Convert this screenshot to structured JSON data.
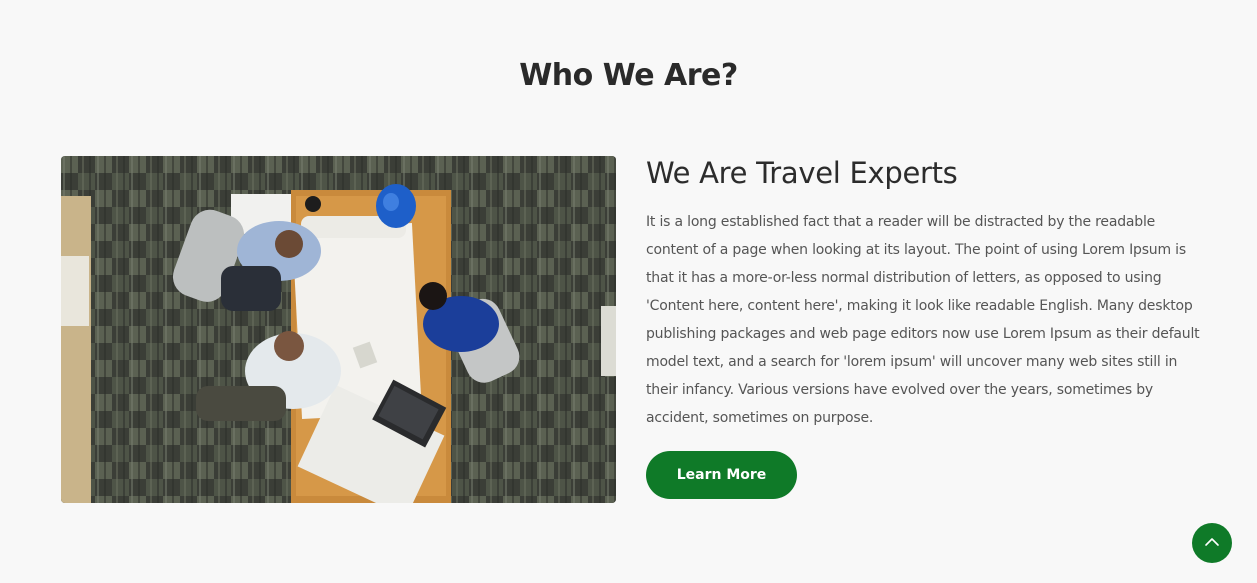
{
  "section": {
    "title": "Who We Are?"
  },
  "about": {
    "heading": "We Are Travel Experts",
    "body": "It is a long established fact that a reader will be distracted by the readable content of a page when looking at its layout. The point of using Lorem Ipsum is that it has a more-or-less normal distribution of letters, as opposed to using 'Content here, content here', making it look like readable English. Many desktop publishing packages and web page editors now use Lorem Ipsum as their default model text, and a search for 'lorem ipsum' will uncover many web sites still in their infancy. Various versions have evolved over the years, sometimes by accident, sometimes on purpose.",
    "button_label": "Learn More"
  },
  "icons": {
    "scroll_top": "chevron-up-icon"
  },
  "colors": {
    "accent": "#0f7a28",
    "background": "#f8f8f8"
  }
}
